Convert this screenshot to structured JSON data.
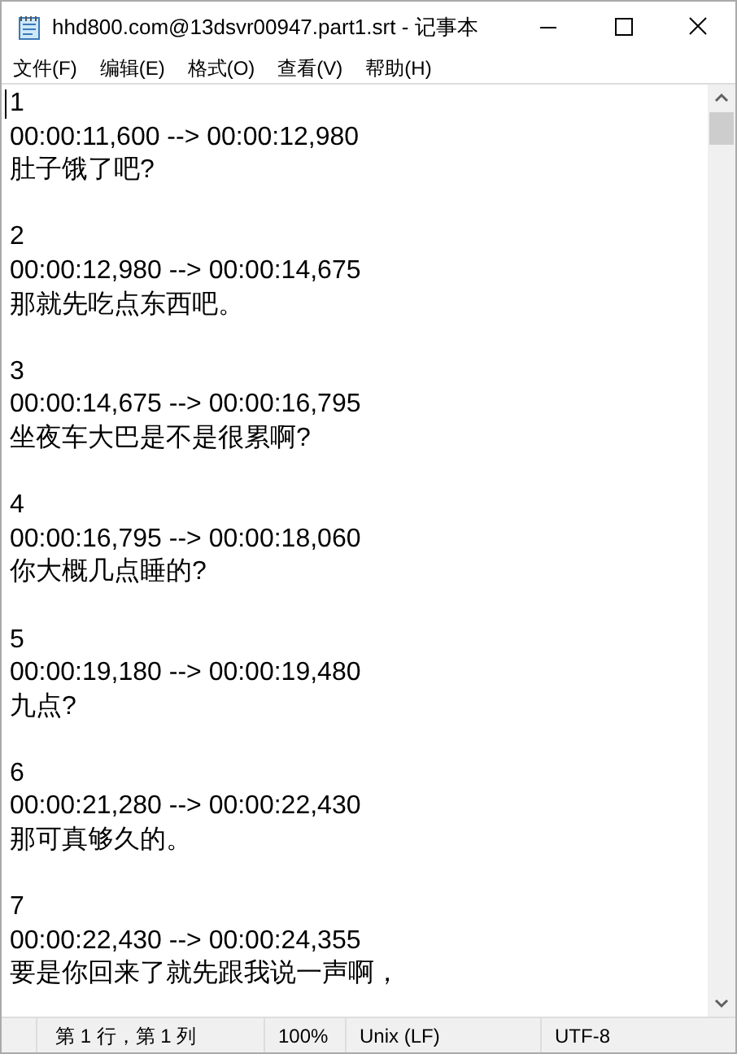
{
  "window": {
    "title": "hhd800.com@13dsvr00947.part1.srt - 记事本"
  },
  "menu": [
    "文件(F)",
    "编辑(E)",
    "格式(O)",
    "查看(V)",
    "帮助(H)"
  ],
  "entries": [
    {
      "number": "1",
      "time": "00:00:11,600 --> 00:00:12,980",
      "text": "肚子饿了吧?"
    },
    {
      "number": "2",
      "time": "00:00:12,980 --> 00:00:14,675",
      "text": "那就先吃点东西吧。"
    },
    {
      "number": "3",
      "time": "00:00:14,675 --> 00:00:16,795",
      "text": "坐夜车大巴是不是很累啊?"
    },
    {
      "number": "4",
      "time": "00:00:16,795 --> 00:00:18,060",
      "text": "你大概几点睡的?"
    },
    {
      "number": "5",
      "time": "00:00:19,180 --> 00:00:19,480",
      "text": "九点?"
    },
    {
      "number": "6",
      "time": "00:00:21,280 --> 00:00:22,430",
      "text": "那可真够久的。"
    },
    {
      "number": "7",
      "time": "00:00:22,430 --> 00:00:24,355",
      "text": "要是你回来了就先跟我说一声啊，"
    }
  ],
  "status_bar": {
    "position": "第 1 行，第 1 列",
    "zoom": "100%",
    "line_ending": "Unix (LF)",
    "encoding": "UTF-8"
  }
}
